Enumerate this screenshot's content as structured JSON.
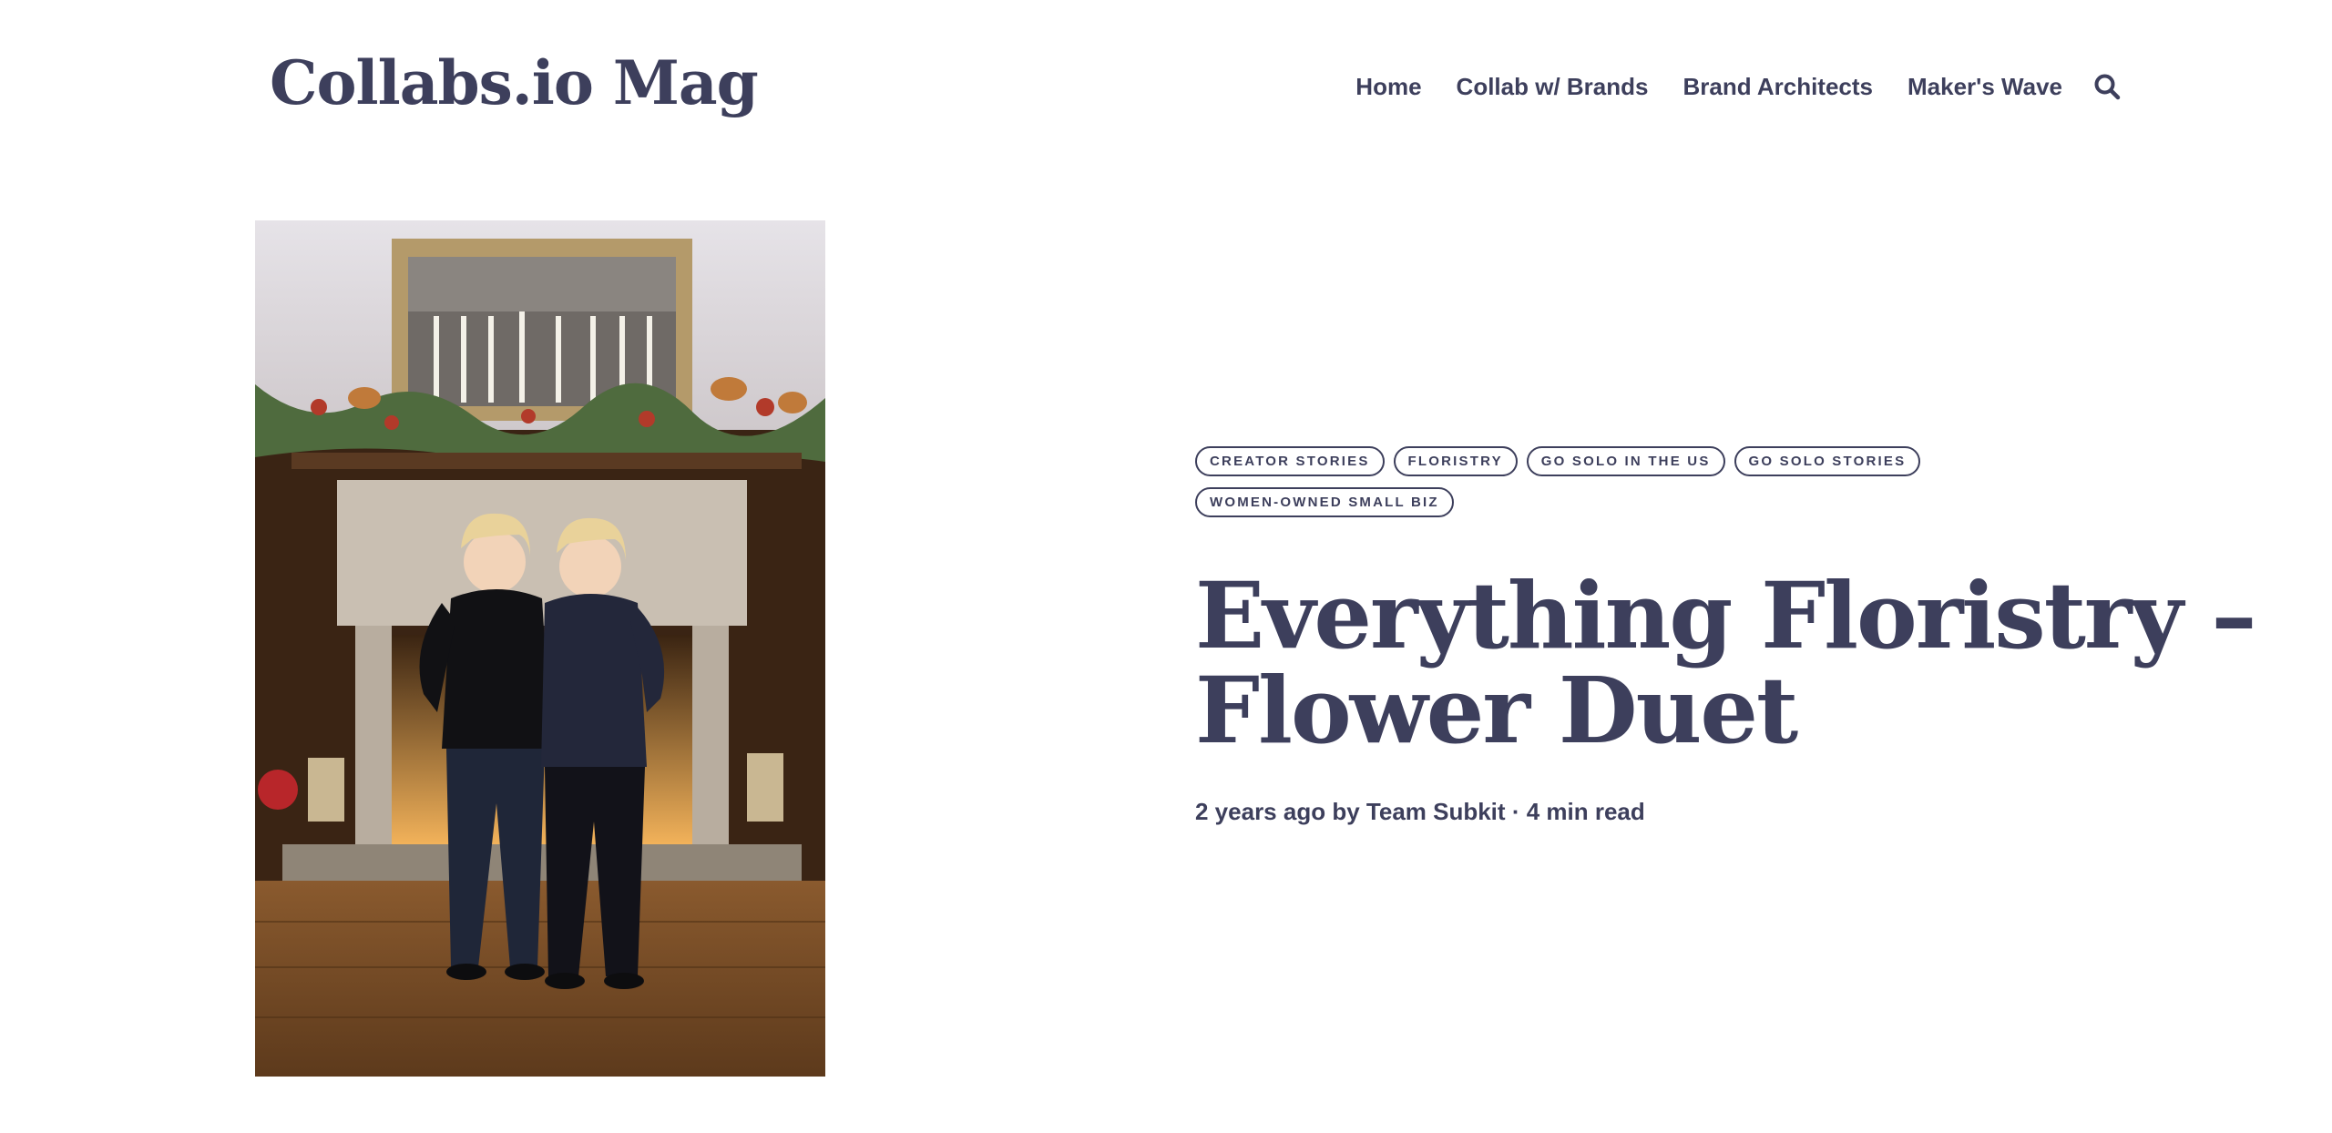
{
  "header": {
    "logo": "Collabs.io Mag",
    "nav": [
      {
        "label": "Home"
      },
      {
        "label": "Collab w/ Brands"
      },
      {
        "label": "Brand Architects"
      },
      {
        "label": "Maker's Wave"
      }
    ],
    "search_icon": "search-icon"
  },
  "article": {
    "tags": [
      "CREATOR STORIES",
      "FLORISTRY",
      "GO SOLO IN THE US",
      "GO SOLO STORIES",
      "WOMEN-OWNED SMALL BIZ"
    ],
    "title": "Everything Floristry – Flower Duet",
    "meta": {
      "time_ago": "2 years ago",
      "by": "by",
      "author": "Team Subkit",
      "separator": "·",
      "read_time": "4 min read"
    }
  },
  "colors": {
    "text": "#3d3f5c",
    "background": "#ffffff"
  }
}
